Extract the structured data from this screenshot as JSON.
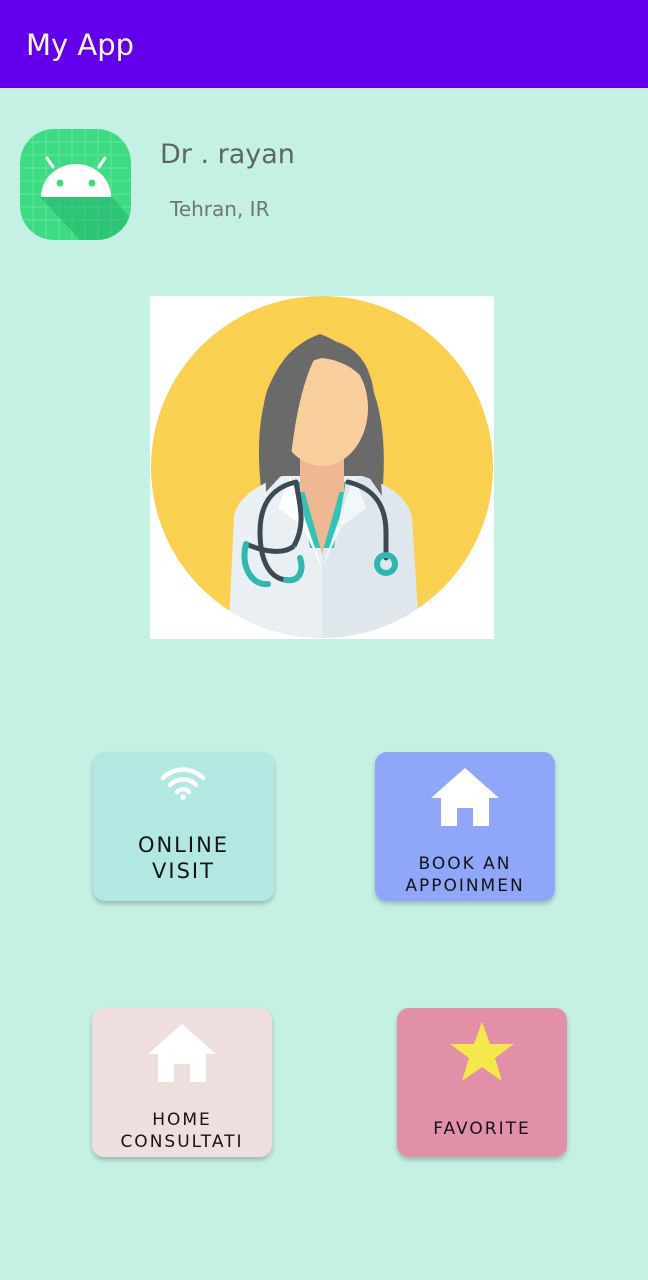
{
  "app_bar": {
    "title": "My App",
    "color": "#6200ee"
  },
  "profile": {
    "name": "Dr . rayan",
    "location": "Tehran, IR",
    "app_icon": "android-launcher-icon",
    "portrait": "doctor-illustration"
  },
  "tiles": [
    {
      "label": "ONLINE\nVISIT",
      "icon": "wifi-icon",
      "color": "#b2e7e2"
    },
    {
      "label": "BOOK AN\nAPPOINMEN",
      "icon": "home-icon",
      "color": "#90a6f8"
    },
    {
      "label": "HOME\nCONSULTATI",
      "icon": "home-icon",
      "color": "#efdede"
    },
    {
      "label": "FAVORITE",
      "icon": "star-icon",
      "color": "#e290a8"
    }
  ]
}
